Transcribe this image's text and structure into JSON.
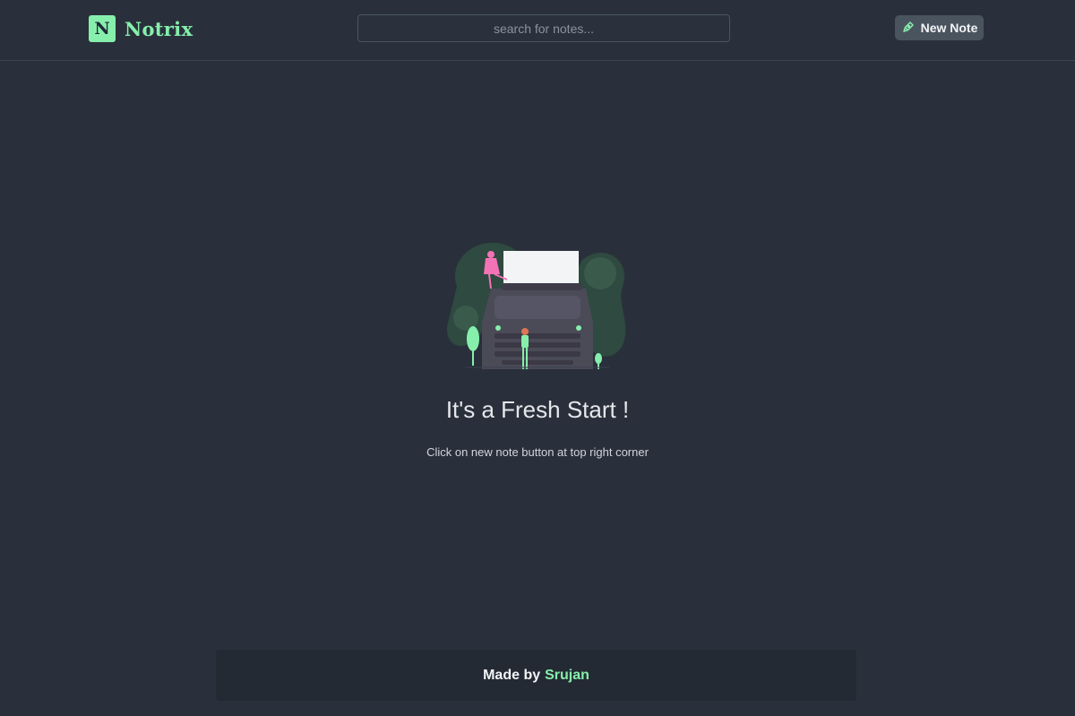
{
  "header": {
    "logo_letter": "N",
    "app_name": "Notrix",
    "search_placeholder": "search for notes...",
    "new_note_label": "New Note"
  },
  "empty_state": {
    "illustration": "typewriter-illustration",
    "title": "It's a Fresh Start !",
    "subtitle": "Click on new note button at top right corner"
  },
  "footer": {
    "prefix": "Made by",
    "author": "Srujan"
  },
  "colors": {
    "background": "#29303b",
    "accent": "#86efac",
    "button": "#4a545f",
    "footer": "#242a33"
  }
}
